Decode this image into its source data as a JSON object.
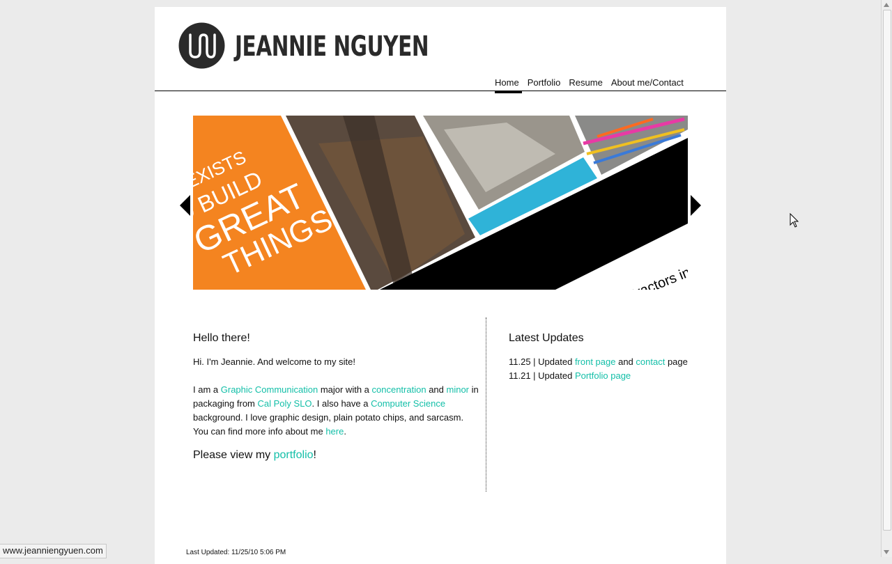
{
  "site": {
    "logo_text": "JEANNIE NGUYEN",
    "logo_monogram": "JN"
  },
  "nav": {
    "items": [
      {
        "label": "Home",
        "active": true
      },
      {
        "label": "Portfolio",
        "active": false
      },
      {
        "label": "Resume",
        "active": false
      },
      {
        "label": "About me/Contact",
        "active": false
      }
    ]
  },
  "slider": {
    "text_lines": [
      "R EXISTS",
      "O BUILD",
      "GREAT",
      "THINGS"
    ],
    "caption_fragment": "ntractors in",
    "colors": {
      "orange": "#f48420",
      "cyan": "#2fb3d8",
      "black": "#000000"
    }
  },
  "intro": {
    "heading": "Hello there!",
    "greeting": "Hi. I'm Jeannie. And welcome to my site!",
    "body": {
      "t1": "I am a ",
      "link_graphic": "Graphic Communication",
      "t2": " major with a ",
      "link_concentration": "concentration",
      "t3": " and ",
      "link_minor": "minor",
      "t4": " in packaging from ",
      "link_calpoly": "Cal Poly SLO",
      "t5": ". I also have a ",
      "link_cs": "Computer Science",
      "t6": " background. I love graphic design, plain potato chips, and sarcasm. You can find more info about me ",
      "link_here": "here",
      "t7": "."
    },
    "cta": {
      "prefix": "Please view my ",
      "link": "portfolio",
      "suffix": "!"
    }
  },
  "updates": {
    "heading": "Latest Updates",
    "items": [
      {
        "prefix": "11.25 | Updated ",
        "link1": "front page",
        "mid": " and ",
        "link2": "contact",
        "suffix": " page"
      },
      {
        "prefix": "11.21 | Updated ",
        "link1": "Portfolio page"
      }
    ]
  },
  "footer": {
    "last_updated": "Last Updated: 11/25/10 5:06 PM"
  },
  "status_bar": {
    "url": "www.jeanniengyuen.com"
  },
  "colors": {
    "link": "#13bfa8",
    "page_bg": "#ebebeb",
    "content_bg": "#ffffff"
  }
}
